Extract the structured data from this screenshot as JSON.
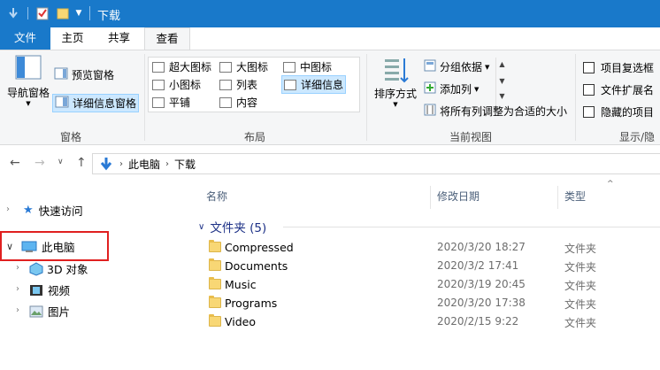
{
  "window": {
    "title": "下载"
  },
  "tabs": {
    "file": "文件",
    "home": "主页",
    "share": "共享",
    "view": "查看"
  },
  "ribbon": {
    "panes": {
      "nav_pane": "导航窗格",
      "preview_pane": "预览窗格",
      "details_pane": "详细信息窗格",
      "group_label": "窗格"
    },
    "layout": {
      "items": [
        "超大图标",
        "大图标",
        "中图标",
        "小图标",
        "列表",
        "详细信息",
        "平铺",
        "内容"
      ],
      "selected": "详细信息",
      "group_label": "布局"
    },
    "current_view": {
      "sort_by": "排序方式",
      "group_by": "分组依据",
      "add_columns": "添加列",
      "fit_columns": "将所有列调整为合适的大小",
      "group_label": "当前视图"
    },
    "show_hide": {
      "item_checkboxes": "项目复选框",
      "file_extensions": "文件扩展名",
      "hidden_items": "隐藏的项目",
      "group_label": "显示/隐藏"
    }
  },
  "address": {
    "crumbs": [
      "此电脑",
      "下载"
    ]
  },
  "nav_pane": {
    "quick_access": "快速访问",
    "this_pc": "此电脑",
    "objects_3d": "3D 对象",
    "videos": "视频",
    "pictures": "图片"
  },
  "list": {
    "columns": {
      "name": "名称",
      "date": "修改日期",
      "type": "类型"
    },
    "group_title": "文件夹 (5)",
    "rows": [
      {
        "name": "Compressed",
        "date": "2020/3/20 18:27",
        "type": "文件夹"
      },
      {
        "name": "Documents",
        "date": "2020/3/2 17:41",
        "type": "文件夹"
      },
      {
        "name": "Music",
        "date": "2020/3/19 20:45",
        "type": "文件夹"
      },
      {
        "name": "Programs",
        "date": "2020/3/20 17:38",
        "type": "文件夹"
      },
      {
        "name": "Video",
        "date": "2020/2/15 9:22",
        "type": "文件夹"
      }
    ]
  },
  "colors": {
    "accent": "#1979ca",
    "selection": "#cce8ff",
    "highlight_border": "#e02020",
    "group_title": "#1e3287"
  }
}
